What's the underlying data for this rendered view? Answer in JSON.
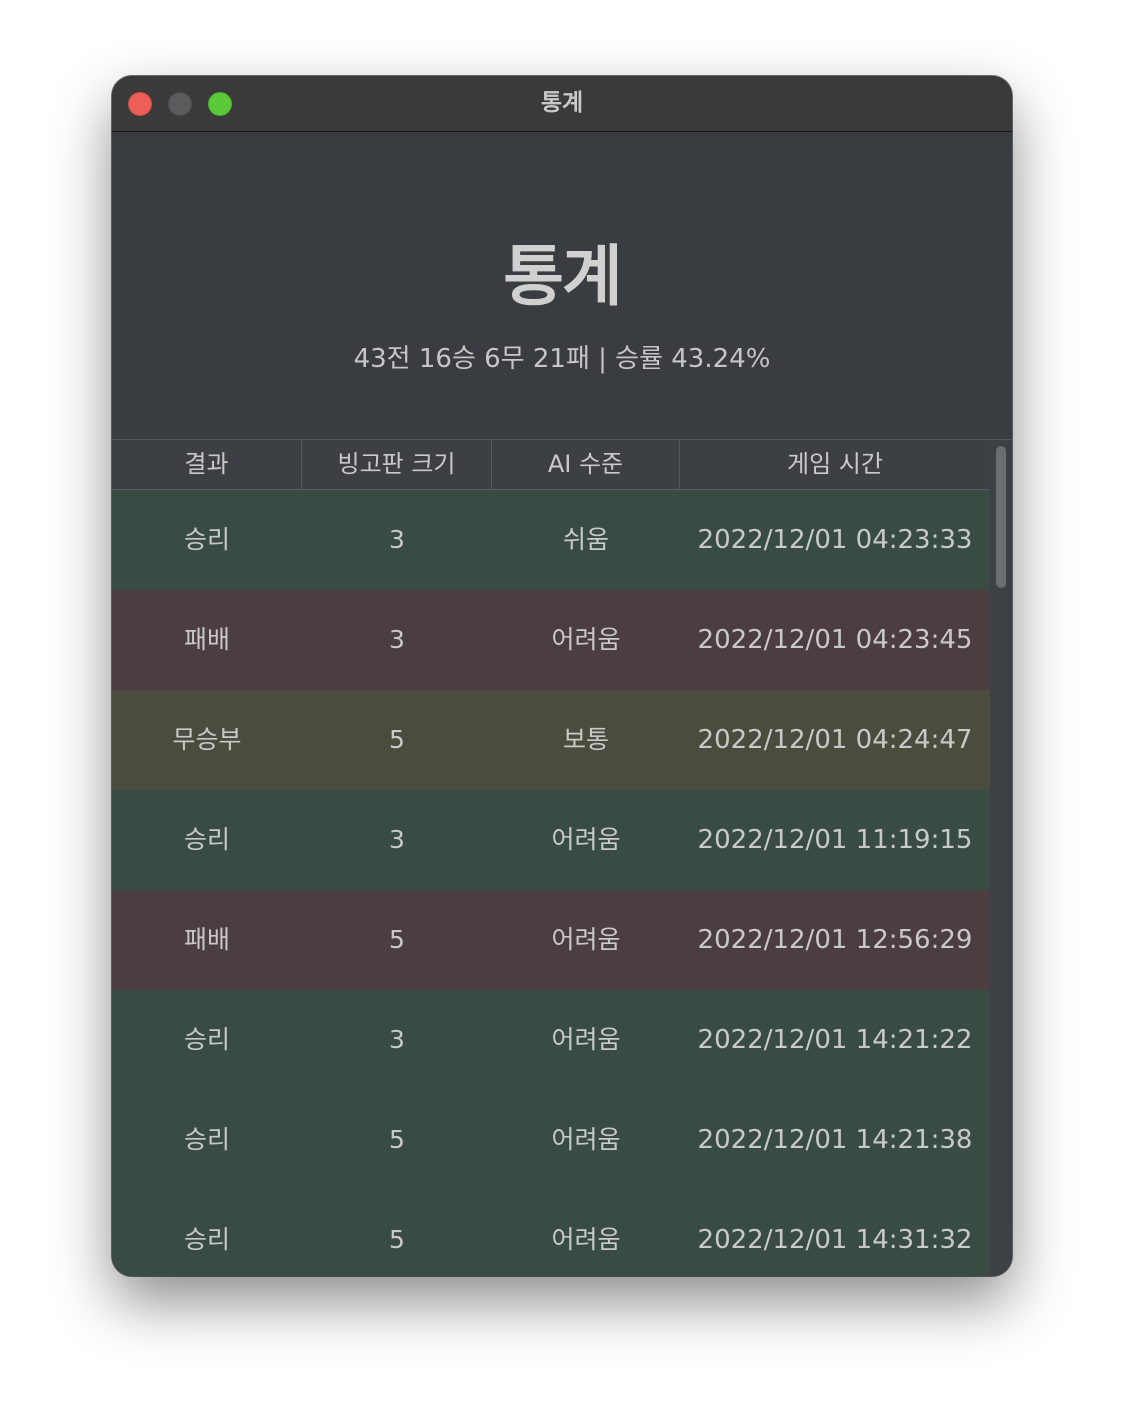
{
  "window": {
    "title": "통계"
  },
  "header": {
    "title": "통계",
    "summary": "43전 16승 6무 21패 | 승률 43.24%"
  },
  "table": {
    "columns": [
      "결과",
      "빙고판 크기",
      "AI 수준",
      "게임 시간"
    ],
    "rows": [
      {
        "result": "승리",
        "size": "3",
        "level": "쉬움",
        "time": "2022/12/01 04:23:33",
        "status": "win"
      },
      {
        "result": "패배",
        "size": "3",
        "level": "어려움",
        "time": "2022/12/01 04:23:45",
        "status": "loss"
      },
      {
        "result": "무승부",
        "size": "5",
        "level": "보통",
        "time": "2022/12/01 04:24:47",
        "status": "draw"
      },
      {
        "result": "승리",
        "size": "3",
        "level": "어려움",
        "time": "2022/12/01 11:19:15",
        "status": "win"
      },
      {
        "result": "패배",
        "size": "5",
        "level": "어려움",
        "time": "2022/12/01 12:56:29",
        "status": "loss"
      },
      {
        "result": "승리",
        "size": "3",
        "level": "어려움",
        "time": "2022/12/01 14:21:22",
        "status": "win"
      },
      {
        "result": "승리",
        "size": "5",
        "level": "어려움",
        "time": "2022/12/01 14:21:38",
        "status": "win"
      },
      {
        "result": "승리",
        "size": "5",
        "level": "어려움",
        "time": "2022/12/01 14:31:32",
        "status": "win"
      }
    ]
  },
  "colors": {
    "win_row": "#394c43",
    "loss_row": "#4b3d40",
    "draw_row": "#4b4c3d",
    "close_button": "#ec5f56",
    "zoom_button": "#5cc93a"
  }
}
